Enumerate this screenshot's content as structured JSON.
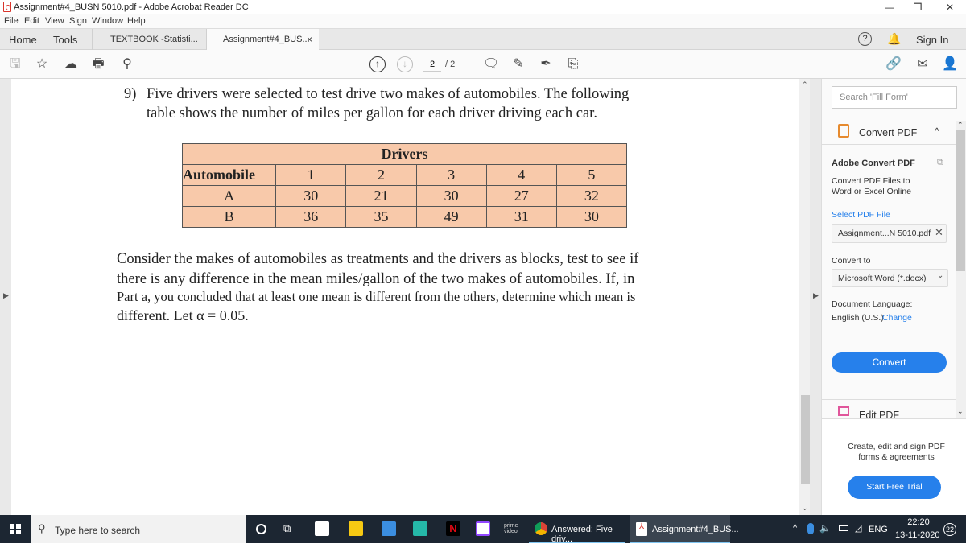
{
  "window": {
    "title": "Assignment#4_BUSN 5010.pdf - Adobe Acrobat Reader DC",
    "controls": {
      "minimize": "—",
      "restore": "❐",
      "close": "✕"
    }
  },
  "menu": [
    "File",
    "Edit",
    "View",
    "Sign",
    "Window",
    "Help"
  ],
  "tabs": {
    "home": "Home",
    "tools": "Tools",
    "documents": [
      {
        "label": "TEXTBOOK -Statisti...",
        "active": false
      },
      {
        "label": "Assignment#4_BUS...",
        "active": true,
        "close": "×"
      }
    ],
    "sign_in": "Sign In"
  },
  "toolbar": {
    "page_current": "2",
    "page_total": "/ 2"
  },
  "document": {
    "question_number": "9)",
    "intro_line1": "Five drivers were selected to test drive two makes of automobiles. The following",
    "intro_line2": "table shows the number of miles per gallon for each driver driving each car.",
    "table": {
      "group_header": "Drivers",
      "row_header": "Automobile",
      "columns": [
        "1",
        "2",
        "3",
        "4",
        "5"
      ],
      "rows": [
        {
          "label": "A",
          "values": [
            "30",
            "21",
            "30",
            "27",
            "32"
          ]
        },
        {
          "label": "B",
          "values": [
            "36",
            "35",
            "49",
            "31",
            "30"
          ]
        }
      ],
      "fill_color": "#f8c9aa"
    },
    "para_line1": "Consider the makes of automobiles as treatments and the drivers as blocks, test to see if",
    "para_line2": "there is any difference in the mean miles/gallon of the two makes of automobiles. If, in",
    "para_line3": "Part a, you concluded that at least one mean is different from the others, determine which mean is",
    "para_line4": "different. Let α = 0.05."
  },
  "panel": {
    "search_placeholder": "Search 'Fill Form'",
    "section_title": "Convert PDF",
    "heading": "Adobe Convert PDF",
    "description": "Convert PDF Files to Word or Excel Online",
    "select_link": "Select PDF File",
    "file_name": "Assignment...N 5010.pdf",
    "convert_to_label": "Convert to",
    "convert_to_value": "Microsoft Word (*.docx)",
    "language_label": "Document Language:",
    "language_value": "English (U.S.)",
    "change_link": "Change",
    "convert_button": "Convert",
    "edit_pdf": "Edit PDF",
    "promo": "Create, edit and sign PDF forms & agreements",
    "trial_button": "Start Free Trial",
    "accent": "#2680eb"
  },
  "taskbar": {
    "search_placeholder": "Type here to search",
    "apps": [
      {
        "label": "Answered: Five driv..."
      },
      {
        "label": "Assignment#4_BUS..."
      }
    ],
    "language": "ENG",
    "time": "22:20",
    "date": "13-11-2020",
    "notifications": "22"
  }
}
